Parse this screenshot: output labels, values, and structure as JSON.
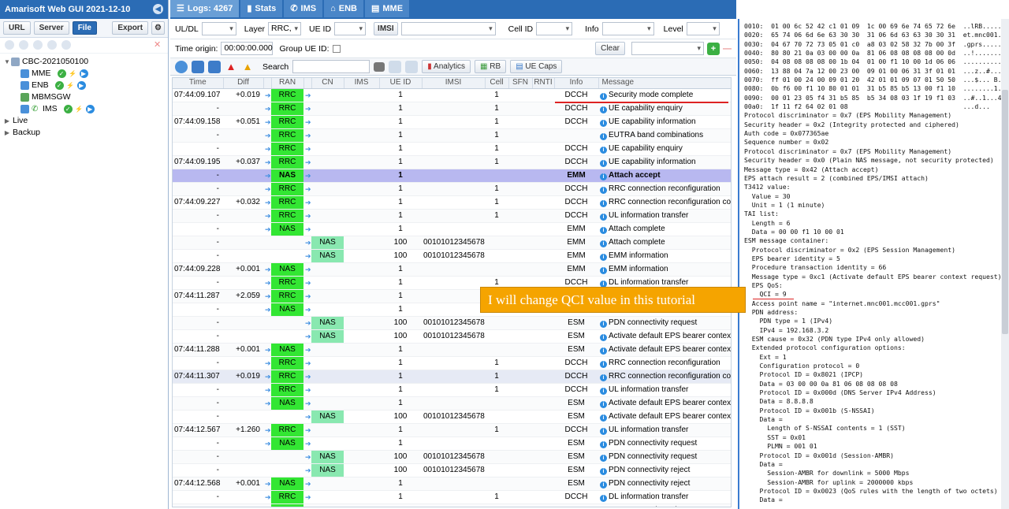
{
  "app": {
    "title": "Amarisoft Web GUI 2021-12-10"
  },
  "left": {
    "buttons": [
      "URL",
      "Server",
      "File",
      "Export"
    ],
    "tree": [
      {
        "label": "CBC-2021050100",
        "level": 0,
        "expanded": true
      },
      {
        "label": "MME",
        "level": 1
      },
      {
        "label": "ENB",
        "level": 1
      },
      {
        "label": "MBMSGW",
        "level": 1
      },
      {
        "label": "IMS",
        "level": 1
      },
      {
        "label": "Live",
        "level": 0,
        "expanded": false
      },
      {
        "label": "Backup",
        "level": 0,
        "expanded": false
      }
    ]
  },
  "tabs": [
    {
      "label": "Logs: 4267"
    },
    {
      "label": "Stats"
    },
    {
      "label": "IMS"
    },
    {
      "label": "ENB"
    },
    {
      "label": "MME"
    }
  ],
  "filters": {
    "uldl_label": "UL/DL",
    "layer_label": "Layer",
    "layer_value": "RRC,",
    "ueid_label": "UE ID",
    "imsi_label": "IMSI",
    "cellid_label": "Cell ID",
    "info_label": "Info",
    "level_label": "Level",
    "time_origin_label": "Time origin:",
    "time_origin_value": "00:00:00.000",
    "group_label": "Group UE ID:",
    "clear_label": "Clear"
  },
  "toolbar": {
    "search_label": "Search",
    "analytics": "Analytics",
    "rb": "RB",
    "uecaps": "UE Caps"
  },
  "columns": [
    "Time",
    "Diff",
    "RAN",
    "CN",
    "IMS",
    "UE ID",
    "IMSI",
    "Cell",
    "SFN",
    "RNTI",
    "Info",
    "Message"
  ],
  "rows": [
    {
      "time": "07:44:09.107",
      "diff": "+0.019",
      "ran": "RRC",
      "cn": "",
      "ueid": "1",
      "imsi": "",
      "cell": "1",
      "info": "DCCH",
      "msg": "Security mode complete"
    },
    {
      "time": "-",
      "diff": "",
      "ran": "RRC",
      "cn": "",
      "ueid": "1",
      "imsi": "",
      "cell": "1",
      "info": "DCCH",
      "msg": "UE capability enquiry"
    },
    {
      "time": "07:44:09.158",
      "diff": "+0.051",
      "ran": "RRC",
      "cn": "",
      "ueid": "1",
      "imsi": "",
      "cell": "1",
      "info": "DCCH",
      "msg": "UE capability information"
    },
    {
      "time": "-",
      "diff": "",
      "ran": "RRC",
      "cn": "",
      "ueid": "1",
      "imsi": "",
      "cell": "1",
      "info": "",
      "msg": "EUTRA band combinations"
    },
    {
      "time": "-",
      "diff": "",
      "ran": "RRC",
      "cn": "",
      "ueid": "1",
      "imsi": "",
      "cell": "1",
      "info": "DCCH",
      "msg": "UE capability enquiry"
    },
    {
      "time": "07:44:09.195",
      "diff": "+0.037",
      "ran": "RRC",
      "cn": "",
      "ueid": "1",
      "imsi": "",
      "cell": "1",
      "info": "DCCH",
      "msg": "UE capability information"
    },
    {
      "time": "-",
      "diff": "",
      "ran": "NAS",
      "cn": "",
      "ueid": "1",
      "imsi": "",
      "cell": "",
      "info": "EMM",
      "msg": "Attach accept",
      "hl": true
    },
    {
      "time": "-",
      "diff": "",
      "ran": "RRC",
      "cn": "",
      "ueid": "1",
      "imsi": "",
      "cell": "1",
      "info": "DCCH",
      "msg": "RRC connection reconfiguration"
    },
    {
      "time": "07:44:09.227",
      "diff": "+0.032",
      "ran": "RRC",
      "cn": "",
      "ueid": "1",
      "imsi": "",
      "cell": "1",
      "info": "DCCH",
      "msg": "RRC connection reconfiguration complete"
    },
    {
      "time": "-",
      "diff": "",
      "ran": "RRC",
      "cn": "",
      "ueid": "1",
      "imsi": "",
      "cell": "1",
      "info": "DCCH",
      "msg": "UL information transfer"
    },
    {
      "time": "-",
      "diff": "",
      "ran": "NAS",
      "cn": "",
      "ueid": "1",
      "imsi": "",
      "cell": "",
      "info": "EMM",
      "msg": "Attach complete"
    },
    {
      "time": "-",
      "diff": "",
      "ran": "",
      "cn": "NAS",
      "ueid": "100",
      "imsi": "001010123456789",
      "cell": "",
      "info": "EMM",
      "msg": "Attach complete"
    },
    {
      "time": "-",
      "diff": "",
      "ran": "",
      "cn": "NAS",
      "ueid": "100",
      "imsi": "001010123456789",
      "cell": "",
      "info": "EMM",
      "msg": "EMM information"
    },
    {
      "time": "07:44:09.228",
      "diff": "+0.001",
      "ran": "NAS",
      "cn": "",
      "ueid": "1",
      "imsi": "",
      "cell": "",
      "info": "EMM",
      "msg": "EMM information"
    },
    {
      "time": "-",
      "diff": "",
      "ran": "RRC",
      "cn": "",
      "ueid": "1",
      "imsi": "",
      "cell": "1",
      "info": "DCCH",
      "msg": "DL information transfer"
    },
    {
      "time": "07:44:11.287",
      "diff": "+2.059",
      "ran": "RRC",
      "cn": "",
      "ueid": "1",
      "imsi": "",
      "cell": "",
      "info": "",
      "msg": ""
    },
    {
      "time": "-",
      "diff": "",
      "ran": "NAS",
      "cn": "",
      "ueid": "1",
      "imsi": "",
      "cell": "",
      "info": "",
      "msg": ""
    },
    {
      "time": "-",
      "diff": "",
      "ran": "",
      "cn": "NAS",
      "ueid": "100",
      "imsi": "001010123456789",
      "cell": "",
      "info": "ESM",
      "msg": "PDN connectivity request"
    },
    {
      "time": "-",
      "diff": "",
      "ran": "",
      "cn": "NAS",
      "ueid": "100",
      "imsi": "001010123456789",
      "cell": "",
      "info": "ESM",
      "msg": "Activate default EPS bearer context reque"
    },
    {
      "time": "07:44:11.288",
      "diff": "+0.001",
      "ran": "NAS",
      "cn": "",
      "ueid": "1",
      "imsi": "",
      "cell": "",
      "info": "ESM",
      "msg": "Activate default EPS bearer context reque"
    },
    {
      "time": "-",
      "diff": "",
      "ran": "RRC",
      "cn": "",
      "ueid": "1",
      "imsi": "",
      "cell": "1",
      "info": "DCCH",
      "msg": "RRC connection reconfiguration"
    },
    {
      "time": "07:44:11.307",
      "diff": "+0.019",
      "ran": "RRC",
      "cn": "",
      "ueid": "1",
      "imsi": "",
      "cell": "1",
      "info": "DCCH",
      "msg": "RRC connection reconfiguration complete",
      "hl2": true
    },
    {
      "time": "-",
      "diff": "",
      "ran": "RRC",
      "cn": "",
      "ueid": "1",
      "imsi": "",
      "cell": "1",
      "info": "DCCH",
      "msg": "UL information transfer"
    },
    {
      "time": "-",
      "diff": "",
      "ran": "NAS",
      "cn": "",
      "ueid": "1",
      "imsi": "",
      "cell": "",
      "info": "ESM",
      "msg": "Activate default EPS bearer context accep"
    },
    {
      "time": "-",
      "diff": "",
      "ran": "",
      "cn": "NAS",
      "ueid": "100",
      "imsi": "001010123456789",
      "cell": "",
      "info": "ESM",
      "msg": "Activate default EPS bearer context accep"
    },
    {
      "time": "07:44:12.567",
      "diff": "+1.260",
      "ran": "RRC",
      "cn": "",
      "ueid": "1",
      "imsi": "",
      "cell": "1",
      "info": "DCCH",
      "msg": "UL information transfer"
    },
    {
      "time": "-",
      "diff": "",
      "ran": "NAS",
      "cn": "",
      "ueid": "1",
      "imsi": "",
      "cell": "",
      "info": "ESM",
      "msg": "PDN connectivity request"
    },
    {
      "time": "-",
      "diff": "",
      "ran": "",
      "cn": "NAS",
      "ueid": "100",
      "imsi": "001010123456789",
      "cell": "",
      "info": "ESM",
      "msg": "PDN connectivity request"
    },
    {
      "time": "-",
      "diff": "",
      "ran": "",
      "cn": "NAS",
      "ueid": "100",
      "imsi": "001010123456789",
      "cell": "",
      "info": "ESM",
      "msg": "PDN connectivity reject"
    },
    {
      "time": "07:44:12.568",
      "diff": "+0.001",
      "ran": "NAS",
      "cn": "",
      "ueid": "1",
      "imsi": "",
      "cell": "",
      "info": "ESM",
      "msg": "PDN connectivity reject"
    },
    {
      "time": "-",
      "diff": "",
      "ran": "RRC",
      "cn": "",
      "ueid": "1",
      "imsi": "",
      "cell": "1",
      "info": "DCCH",
      "msg": "DL information transfer"
    },
    {
      "time": "07:44:29.633",
      "diff": "+17.065",
      "ran": "RRC",
      "cn": "",
      "ueid": "1",
      "imsi": "",
      "cell": "1",
      "info": "DCCH",
      "msg": "RRC connection release"
    }
  ],
  "callout": "I will change QCI value in this tutorial",
  "dump": [
    "0010:  01 00 6c 52 42 c1 01 09  1c 00 69 6e 74 65 72 6e  ..lRB.......intern",
    "0020:  65 74 06 6d 6e 63 30 30  31 06 6d 63 63 30 30 31  et.mnc001.mcc001",
    "0030:  04 67 70 72 73 05 01 c0  a8 03 02 58 32 7b 00 3f  .gprs......X2{.?",
    "0040:  80 80 21 0a 03 00 00 0a  81 06 08 08 08 08 00 0d  ..!.............",
    "0050:  04 08 08 08 08 00 1b 04  01 00 f1 10 00 1d 06 06  ................",
    "0060:  13 88 04 7a 12 00 23 00  09 01 00 06 31 3f 01 01  ...z..#.....1?..",
    "0070:  ff 01 00 24 00 09 01 20  42 01 01 09 07 01 50 50  ...$... B.....PP",
    "0080:  0b f6 00 f1 10 80 01 01  31 b5 85 b5 13 00 f1 10  ........1.......",
    "0090:  00 01 23 05 f4 31 b5 85  b5 34 08 03 1f 19 f1 03  ..#..1...4......",
    "00a0:  1f 11 f2 64 02 01 08                              ...d...",
    "Protocol discriminator = 0x7 (EPS Mobility Management)",
    "Security header = 0x2 (Integrity protected and ciphered)",
    "Auth code = 0x077365ae",
    "Sequence number = 0x02",
    "Protocol discriminator = 0x7 (EPS Mobility Management)",
    "Security header = 0x0 (Plain NAS message, not security protected)",
    "Message type = 0x42 (Attach accept)",
    "EPS attach result = 2 (combined EPS/IMSI attach)",
    "T3412 value:",
    "  Value = 30",
    "  Unit = 1 (1 minute)",
    "TAI list:",
    "  Length = 6",
    "  Data = 00 00 f1 10 00 01",
    "ESM message container:",
    "  Protocol discriminator = 0x2 (EPS Session Management)",
    "  EPS bearer identity = 5",
    "  Procedure transaction identity = 66",
    "  Message type = 0xc1 (Activate default EPS bearer context request)",
    "  EPS QoS:",
    "    QCI = 9",
    "  Access point name = \"internet.mnc001.mcc001.gprs\"",
    "  PDN address:",
    "    PDN type = 1 (IPv4)",
    "    IPv4 = 192.168.3.2",
    "  ESM cause = 0x32 (PDN type IPv4 only allowed)",
    "  Extended protocol configuration options:",
    "    Ext = 1",
    "    Configuration protocol = 0",
    "    Protocol ID = 0x8021 (IPCP)",
    "    Data = 03 00 00 0a 81 06 08 08 08 08",
    "    Protocol ID = 0x000d (DNS Server IPv4 Address)",
    "    Data = 8.8.8.8",
    "    Protocol ID = 0x001b (S-NSSAI)",
    "    Data =",
    "      Length of S-NSSAI contents = 1 (SST)",
    "      SST = 0x01",
    "      PLMN = 001 01",
    "    Protocol ID = 0x001d (Session-AMBR)",
    "    Data =",
    "      Session-AMBR for downlink = 5000 Mbps",
    "      Session-AMBR for uplink = 2000000 kbps",
    "    Protocol ID = 0x0023 (QoS rules with the length of two octets)",
    "    Data ="
  ],
  "colors": {
    "brand": "#2b6cb5",
    "ran": "#33e633",
    "cn": "#89e8b0",
    "highlight": "#b8b8f0",
    "callout": "#f5a400"
  }
}
